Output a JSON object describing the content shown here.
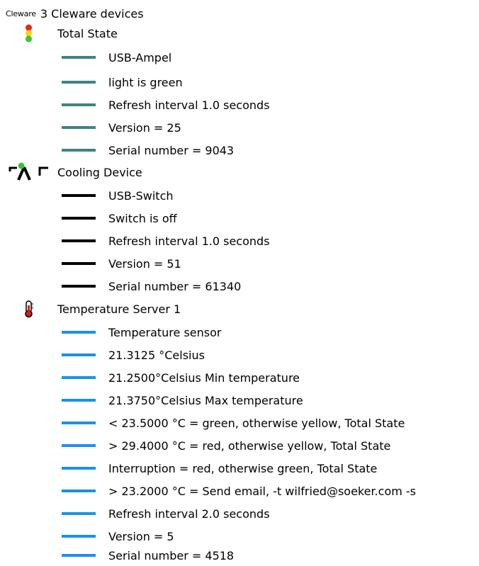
{
  "tree": {
    "root": {
      "logo_text": "Cleware",
      "label": "3 Cleware devices"
    },
    "devices": [
      {
        "label": "Total State",
        "icon": "traffic-light-icon",
        "line_color": "#3f8482",
        "properties": [
          "USB-Ampel",
          "light is green",
          "Refresh interval 1.0 seconds",
          "Version = 25",
          "Serial number = 9043"
        ]
      },
      {
        "label": "Cooling Device",
        "icon": "switch-icon",
        "line_color": "#000000",
        "properties": [
          "USB-Switch",
          "Switch is off",
          "Refresh interval 1.0 seconds",
          "Version = 51",
          "Serial number = 61340"
        ]
      },
      {
        "label": "Temperature Server 1",
        "icon": "thermometer-icon",
        "line_color": "#1a90f0",
        "properties": [
          "Temperature sensor",
          "21.3125 °Celsius",
          "21.2500°Celsius Min temperature",
          "21.3750°Celsius Max temperature",
          "< 23.5000 °C = green, otherwise yellow, Total State",
          "> 29.4000 °C = red, otherwise yellow, Total State",
          "Interruption = red, otherwise green, Total State",
          "> 23.2000 °C = Send email, -t wilfried@soeker.com -s",
          "Refresh interval 2.0 seconds",
          "Version = 5",
          "Serial number = 4518"
        ]
      }
    ]
  }
}
